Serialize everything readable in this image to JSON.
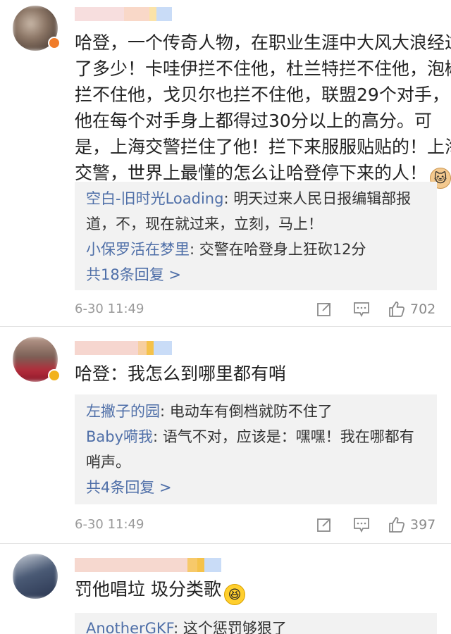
{
  "comments": [
    {
      "text_lines": [
        "哈登，一个传奇人物，在职业生涯中大风大浪经过",
        "了多少！卡哇伊拦不住他，杜兰特拦不住他，泡椒",
        "拦不住他，戈贝尔也拦不住他，联盟29个对手，",
        "他在每个对手身上都得过30分以上的高分。可",
        "是，上海交警拦住了他！拦下来服服贴贴的！上海",
        "交警，世界上最懂的怎么让哈登停下来的人！"
      ],
      "emoji": "cat-emoji",
      "replies": [
        {
          "name": "空白-旧时光Loading",
          "text": "明天过来人民日报编辑部报",
          "cont": "道，不，现在就过来，立刻，马上！"
        },
        {
          "name": "小保罗活在梦里",
          "text": "交警在哈登身上狂砍12分",
          "cont": ""
        }
      ],
      "more": "共18条回复 >",
      "time": "6-30 11:49",
      "likes": "702"
    },
    {
      "text_lines": [
        "哈登：我怎么到哪里都有哨"
      ],
      "replies": [
        {
          "name": "左撇子的园",
          "text": "电动车有倒档就防不住了",
          "cont": ""
        },
        {
          "name": "Baby嗬我",
          "text": "语气不对，应该是：嘿嘿！我在哪都有",
          "cont": "哨声。"
        }
      ],
      "more": "共4条回复 >",
      "time": "6-30 11:49",
      "likes": "397"
    },
    {
      "text_lines": [
        "罚他唱垃 圾分类歌"
      ],
      "emoji": "laughing-emoji",
      "replies": [
        {
          "name": "AnotherGKF",
          "text": "这个惩罚够狠了",
          "cont": ""
        }
      ]
    }
  ],
  "colors": {
    "reply_name": "#4f6fa8",
    "reply_bg": "#f2f2f2",
    "meta": "#9a9a9a"
  }
}
